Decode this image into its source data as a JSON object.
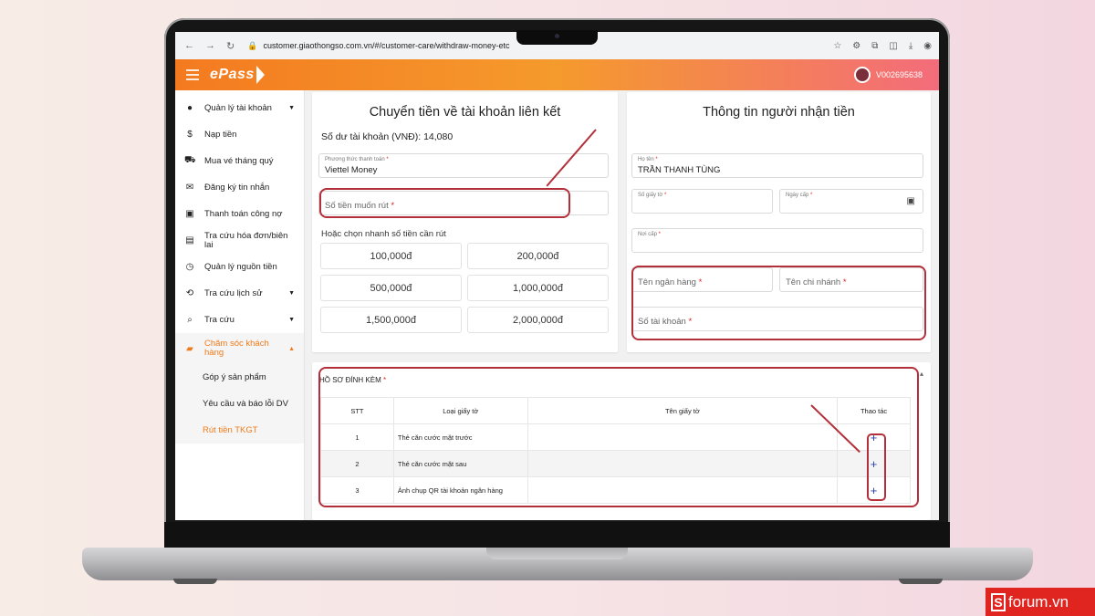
{
  "browser": {
    "url": "customer.giaothongso.com.vn/#/customer-care/withdraw-money-etc"
  },
  "header": {
    "logo": "ePass",
    "user_id": "V002695638"
  },
  "sidebar": {
    "items": [
      {
        "label": "Quản lý tài khoản",
        "icon": "account-circle-icon"
      },
      {
        "label": "Nạp tiền",
        "icon": "dollar-icon"
      },
      {
        "label": "Mua vé tháng quý",
        "icon": "cart-icon"
      },
      {
        "label": "Đăng ký tin nhắn",
        "icon": "mail-icon"
      },
      {
        "label": "Thanh toán công nợ",
        "icon": "wallet-icon"
      },
      {
        "label": "Tra cứu hóa đơn/biên lai",
        "icon": "receipt-icon"
      },
      {
        "label": "Quản lý nguồn tiền",
        "icon": "clock-icon"
      },
      {
        "label": "Tra cứu lịch sử",
        "icon": "history-icon"
      },
      {
        "label": "Tra cứu",
        "icon": "search-icon"
      },
      {
        "label": "Chăm sóc khách hàng",
        "icon": "chat-icon"
      }
    ],
    "sub_items": [
      {
        "label": "Góp ý sản phẩm"
      },
      {
        "label": "Yêu cầu và báo lỗi DV"
      },
      {
        "label": "Rút tiền TKGT"
      }
    ]
  },
  "transfer": {
    "title": "Chuyển tiền về tài khoản liên kết",
    "balance": "Số dư tài khoản (VNĐ): 14,080",
    "method_label": "Phương thức thanh toán",
    "method_value": "Viettel Money",
    "amount_placeholder": "Số tiền muốn rút",
    "quick_label": "Hoặc chọn nhanh số tiền cần rút",
    "amounts": [
      "100,000đ",
      "200,000đ",
      "500,000đ",
      "1,000,000đ",
      "1,500,000đ",
      "2,000,000đ"
    ]
  },
  "recipient": {
    "title": "Thông tin người nhận tiền",
    "name_label": "Họ tên",
    "name_value": "TRẦN THANH TÙNG",
    "id_label": "Số giấy tờ",
    "date_label": "Ngày cấp",
    "place_label": "Nơi cấp",
    "bank_placeholder": "Tên ngân hàng",
    "branch_placeholder": "Tên chi nhánh",
    "account_placeholder": "Số tài khoản"
  },
  "attachments": {
    "title": "HỒ SƠ ĐÍNH KÈM",
    "columns": [
      "STT",
      "Loại giấy tờ",
      "Tên giấy tờ",
      "Thao tác"
    ],
    "rows": [
      {
        "stt": "1",
        "type": "Thẻ căn cước mặt trước",
        "name": ""
      },
      {
        "stt": "2",
        "type": "Thẻ căn cước mặt sau",
        "name": ""
      },
      {
        "stt": "3",
        "type": "Ảnh chụp QR tài khoản ngân hàng",
        "name": ""
      }
    ]
  },
  "watermark": "forum.vn"
}
